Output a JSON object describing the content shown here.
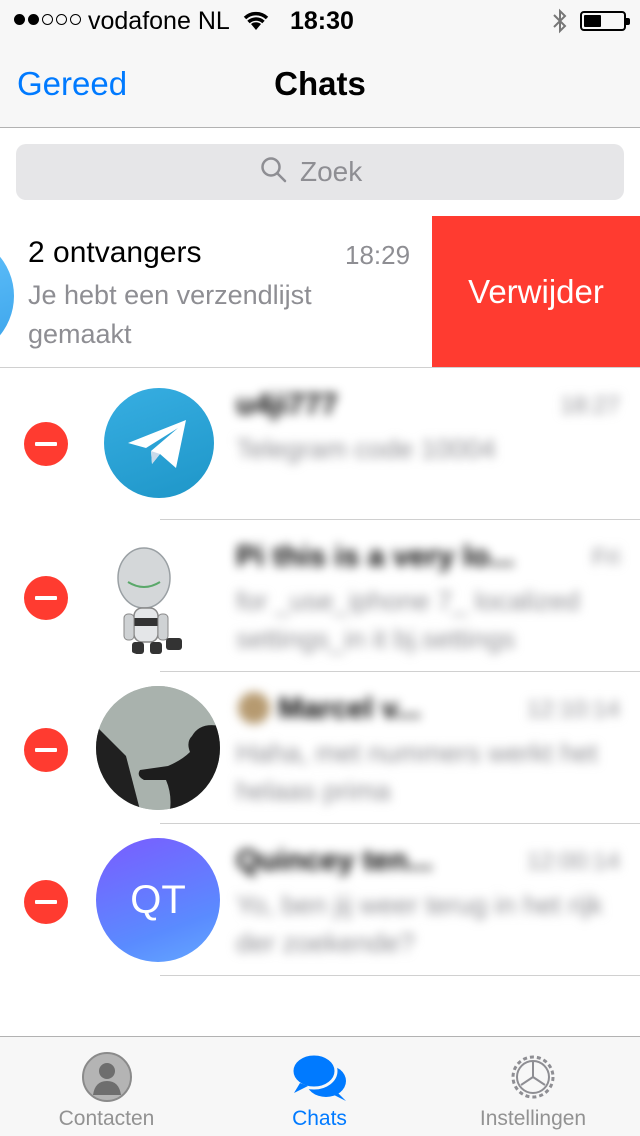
{
  "status_bar": {
    "carrier": "vodafone NL",
    "time": "18:30",
    "signal_bars_filled": 2,
    "signal_bars_total": 5
  },
  "nav": {
    "left_button": "Gereed",
    "title": "Chats"
  },
  "search": {
    "placeholder": "Zoek"
  },
  "swiped_chat": {
    "name": "2 ontvangers",
    "time": "18:29",
    "preview": "Je hebt een verzendlijst gemaakt",
    "delete_label": "Verwijder"
  },
  "chats": [
    {
      "name": "u4ji777",
      "time": "18:27",
      "preview": "Telegram code 10004"
    },
    {
      "name": "Pi this is a very lo...",
      "time": "Fri",
      "preview": "for _use_iphone 7_ localized settings_in it bj.settings"
    },
    {
      "name": "Marcel v...",
      "time": "12:10:14",
      "preview": "Haha, met nummers werkt het helaas prima"
    },
    {
      "name": "Quincey ten...",
      "time": "12:00:14",
      "preview": "Yo, ben jij weer terug in het rijk der zoekende?"
    }
  ],
  "chat_avatars": {
    "row4_initials": "QT"
  },
  "tabs": [
    {
      "label": "Contacten",
      "icon": "person-icon",
      "active": false
    },
    {
      "label": "Chats",
      "icon": "chat-bubbles-icon",
      "active": true
    },
    {
      "label": "Instellingen",
      "icon": "gear-icon",
      "active": false
    }
  ],
  "colors": {
    "accent": "#007aff",
    "destructive": "#ff3b30"
  }
}
